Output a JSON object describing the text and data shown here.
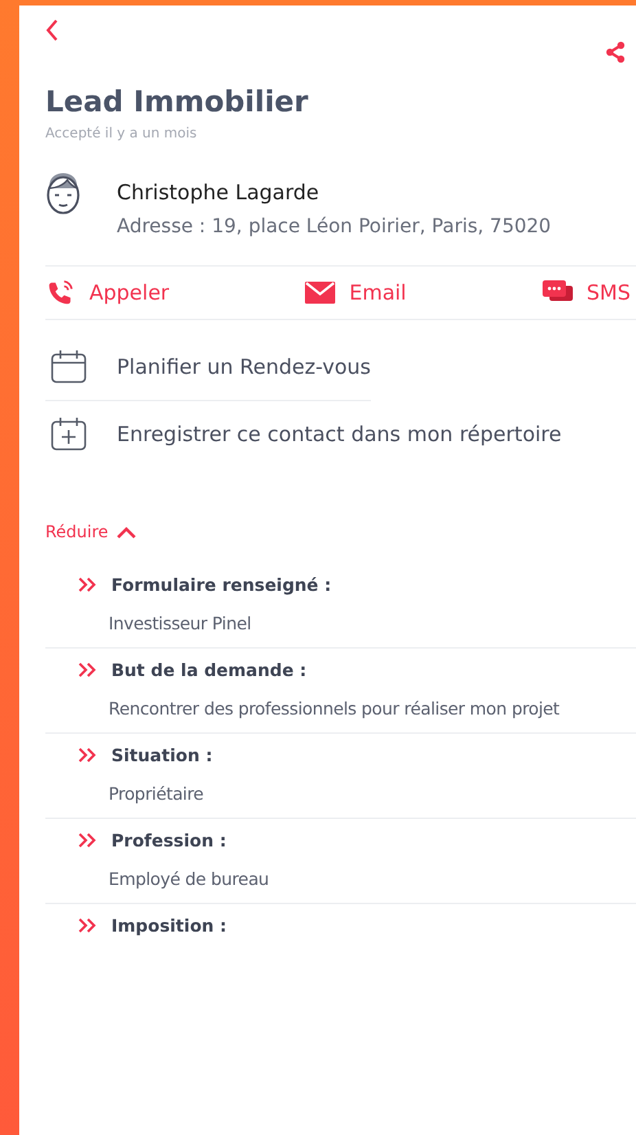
{
  "header": {
    "title": "Lead Immobilier",
    "subtitle": "Accepté il y a un mois"
  },
  "contact": {
    "name": "Christophe Lagarde",
    "address": "Adresse : 19, place Léon Poirier, Paris, 75020"
  },
  "actions": [
    {
      "kind": "call",
      "label": "Appeler"
    },
    {
      "kind": "email",
      "label": "Email"
    },
    {
      "kind": "sms",
      "label": "SMS"
    }
  ],
  "options": [
    {
      "kind": "calendar",
      "label": "Planifier un Rendez-vous"
    },
    {
      "kind": "add",
      "label": "Enregistrer ce contact dans mon répertoire"
    }
  ],
  "toggle": {
    "label": "Réduire",
    "expanded": true
  },
  "details": [
    {
      "label": "Formulaire renseigné :",
      "value": "Investisseur Pinel"
    },
    {
      "label": "But de la demande :",
      "value": "Rencontrer des professionnels pour réaliser mon projet"
    },
    {
      "label": "Situation :",
      "value": "Propriétaire"
    },
    {
      "label": "Profession :",
      "value": "Employé de bureau"
    },
    {
      "label": "Imposition :"
    }
  ]
}
